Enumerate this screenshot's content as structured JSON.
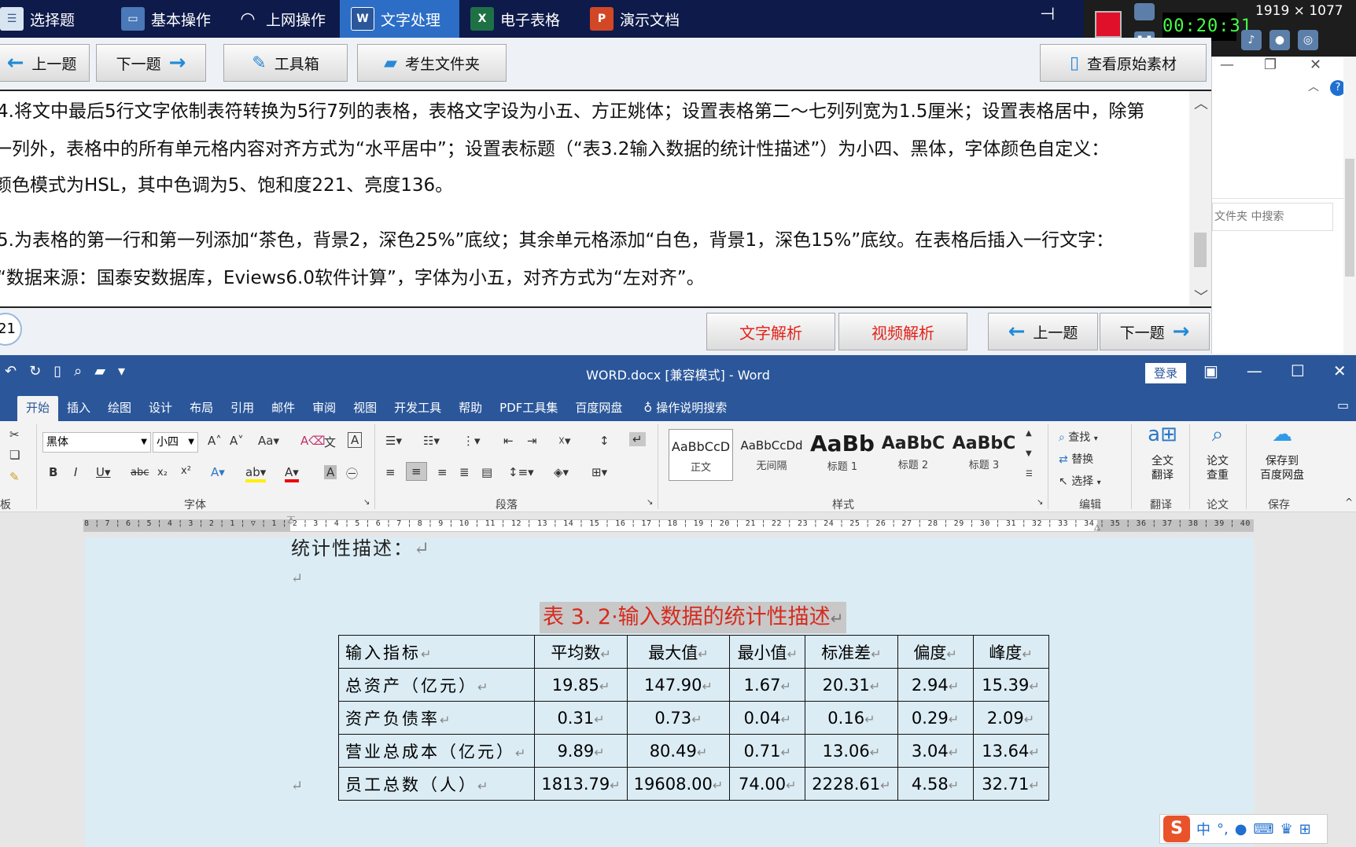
{
  "exam_app": {
    "top_tabs": [
      {
        "label": "选择题",
        "icon": "checklist-icon"
      },
      {
        "label": "基本操作",
        "icon": "monitor-icon"
      },
      {
        "label": "上网操作",
        "icon": "wifi-icon"
      },
      {
        "label": "文字处理",
        "icon": "word-icon",
        "active": true
      },
      {
        "label": "电子表格",
        "icon": "excel-icon"
      },
      {
        "label": "演示文档",
        "icon": "powerpoint-icon"
      }
    ],
    "nav": {
      "prev_label": "上一题",
      "next_label": "下一题",
      "toolbox_label": "工具箱",
      "folder_label": "考生文件夹",
      "view_material_label": "查看原始素材"
    },
    "question_lines": [
      "4.将文中最后5行文字依制表符转换为5行7列的表格，表格文字设为小五、方正姚体；设置表格第二～七列列宽为1.5厘米；设置表格居中，除第",
      "一列外，表格中的所有单元格内容对齐方式为“水平居中”；设置表标题（“表3.2输入数据的统计性描述”）为小四、黑体，字体颜色自定义：",
      "颜色模式为HSL，其中色调为5、饱和度221、亮度136。",
      "5.为表格的第一行和第一列添加“茶色，背景2，深色25%”底纹；其余单元格添加“白色，背景1，深色15%”底纹。在表格后插入一行文字：",
      "“数据来源：国泰安数据库，Eviews6.0软件计算”，字体为小五，对齐方式为“左对齐”。"
    ],
    "question_number": "21",
    "bottom": {
      "text_analysis_label": "文字解析",
      "video_analysis_label": "视频解析",
      "prev_label": "上一题",
      "next_label": "下一题"
    }
  },
  "recorder": {
    "timer": "00:20:31",
    "resolution": "1919 × 1077"
  },
  "explorer": {
    "search_placeholder": "文件夹 中搜索"
  },
  "word": {
    "title": "WORD.docx [兼容模式] - Word",
    "login_label": "登录",
    "tabs": [
      "开始",
      "插入",
      "绘图",
      "设计",
      "布局",
      "引用",
      "邮件",
      "审阅",
      "视图",
      "开发工具",
      "帮助",
      "PDF工具集",
      "百度网盘",
      "操作说明搜索"
    ],
    "active_tab": "开始",
    "ribbon": {
      "font_name": "黑体",
      "font_size": "小四",
      "group_font": "字体",
      "group_paragraph": "段落",
      "group_styles": "样式",
      "group_edit": "编辑",
      "group_translate": "翻译",
      "group_paper": "论文",
      "group_save": "保存",
      "group_clipboard": "板",
      "styles": [
        {
          "sample": "AaBbCcD",
          "name": "正文"
        },
        {
          "sample": "AaBbCcDd",
          "name": "无间隔"
        },
        {
          "sample": "AaBb",
          "name": "标题 1"
        },
        {
          "sample": "AaBbC",
          "name": "标题 2"
        },
        {
          "sample": "AaBbC",
          "name": "标题 3"
        }
      ],
      "find_label": "查找",
      "replace_label": "替换",
      "select_label": "选择",
      "translate_label": "全文\n翻译",
      "paper_check_label": "论文\n查重",
      "save_baidu_label": "保存到\n百度网盘"
    },
    "document": {
      "prev_line_text": "统计性描述：",
      "caption": "表 3. 2·输入数据的统计性描述",
      "table": {
        "headers": [
          "输入指标",
          "平均数",
          "最大值",
          "最小值",
          "标准差",
          "偏度",
          "峰度"
        ],
        "rows": [
          [
            "总资产（亿元）",
            "19.85",
            "147.90",
            "1.67",
            "20.31",
            "2.94",
            "15.39"
          ],
          [
            "资产负债率",
            "0.31",
            "0.73",
            "0.04",
            "0.16",
            "0.29",
            "2.09"
          ],
          [
            "营业总成本（亿元）",
            "9.89",
            "80.49",
            "0.71",
            "13.06",
            "3.04",
            "13.64"
          ],
          [
            "员工总数（人）",
            "1813.79",
            "19608.00",
            "74.00",
            "2228.61",
            "4.58",
            "32.71"
          ]
        ]
      }
    }
  },
  "ime": {
    "mode_label": "中"
  }
}
